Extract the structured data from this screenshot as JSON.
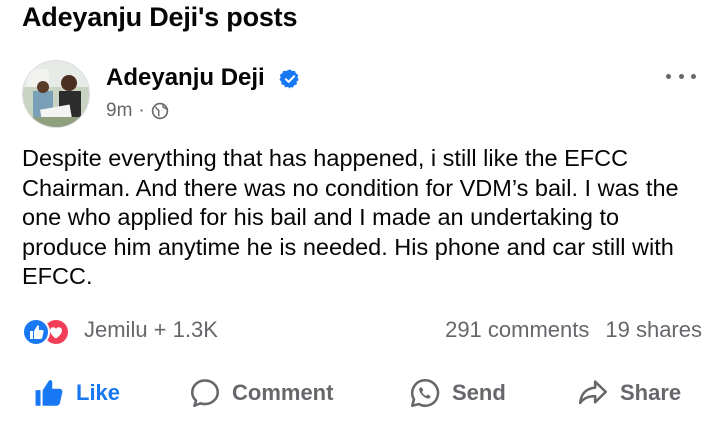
{
  "page": {
    "title": "Adeyanju Deji's posts"
  },
  "post": {
    "author": "Adeyanju Deji",
    "time": "9m",
    "separator": "·",
    "audience_icon": "globe-icon",
    "verified_icon": "verified-badge-icon",
    "body": "Despite everything that has happened, i still like the EFCC Chairman. And there was no condition for VDM’s bail. I was the one who applied for his bail and I made an undertaking to produce him anytime he is needed. His phone and car still with EFCC."
  },
  "reactions": {
    "icons": [
      "like-reaction-icon",
      "love-reaction-icon"
    ],
    "names": "Jemilu + 1.3K",
    "comments": "291 comments",
    "shares": "19 shares"
  },
  "actions": {
    "like": "Like",
    "comment": "Comment",
    "send": "Send",
    "share": "Share"
  },
  "colors": {
    "brand_blue": "#1877f2",
    "love_red": "#f33e58",
    "secondary_text": "#65676b",
    "primary_text": "#050505"
  }
}
